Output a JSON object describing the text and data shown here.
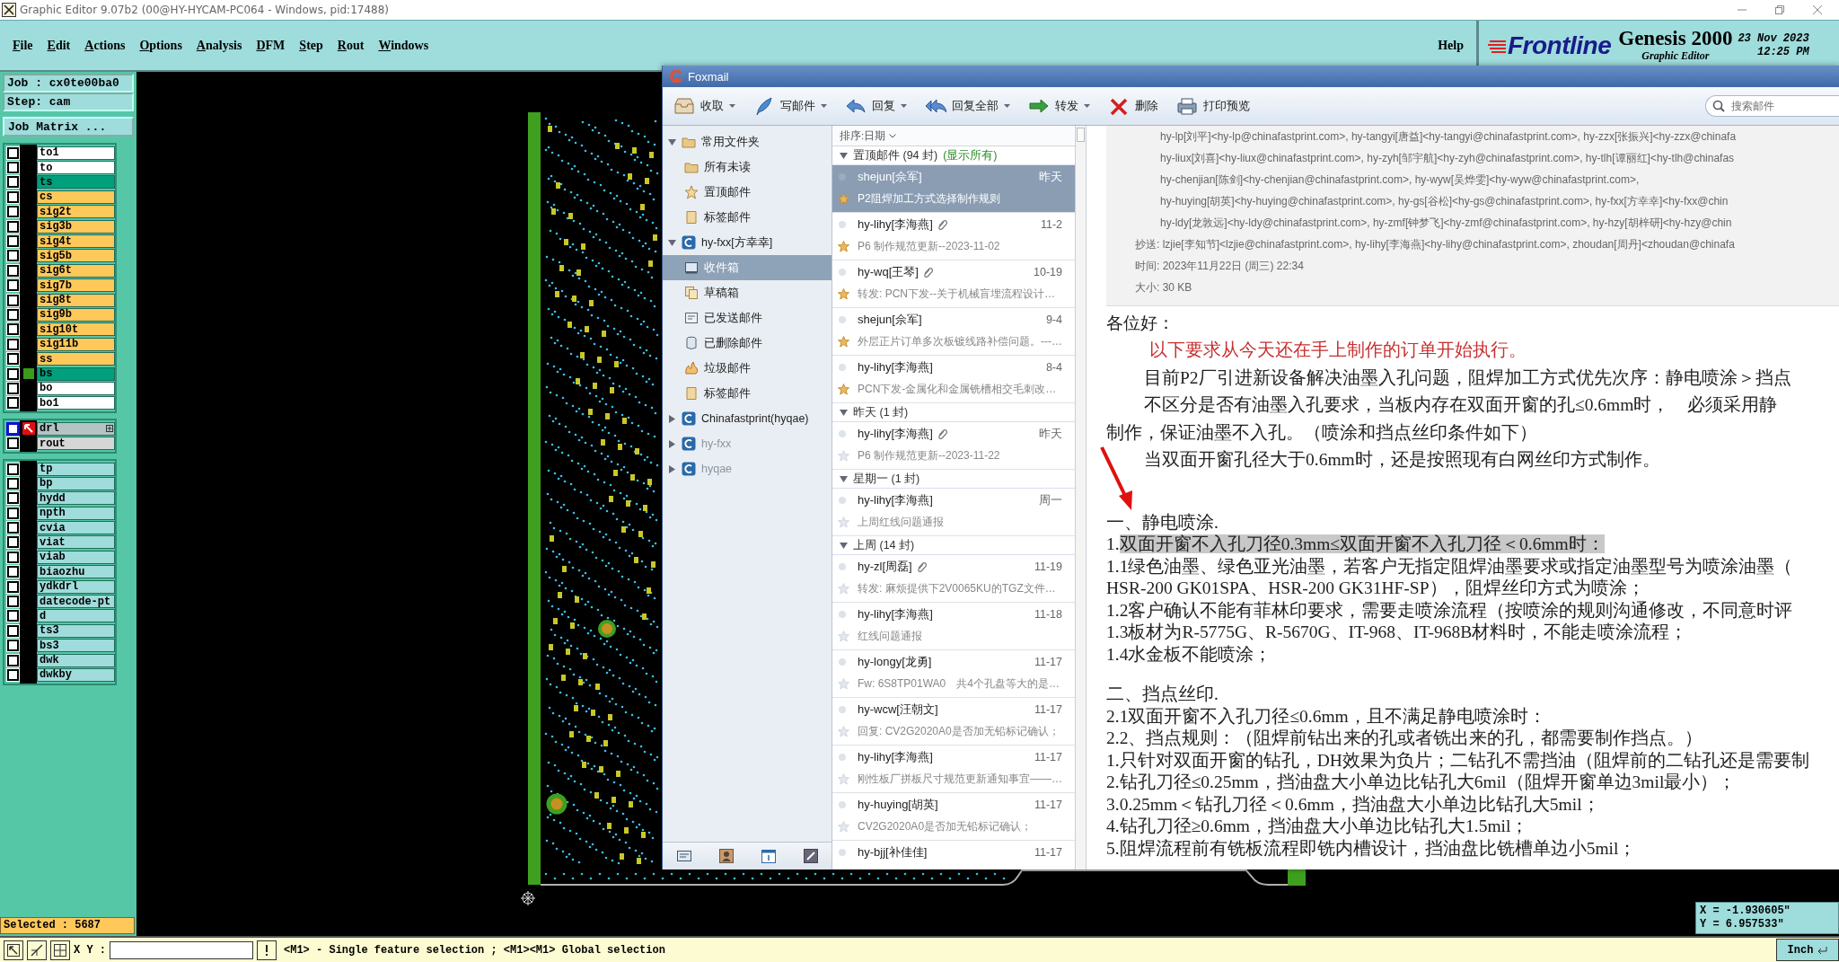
{
  "app_window": {
    "title": "Graphic Editor 9.07b2 (00@HY-HYCAM-PC064 - Windows, pid:17488)"
  },
  "menu": [
    "File",
    "Edit",
    "Actions",
    "Options",
    "Analysis",
    "DFM",
    "Step",
    "Rout",
    "Windows"
  ],
  "help": "Help",
  "brand": {
    "logo": "Frontline",
    "product": "Genesis 2000",
    "subtitle": "Graphic Editor",
    "date": "23 Nov 2023",
    "time": "12:25 PM"
  },
  "job": {
    "job": "Job : cx0te00ba0",
    "step": "Step: cam",
    "matrix_button": "Job Matrix ..."
  },
  "layer_groups": [
    {
      "layers": [
        {
          "name": "to1",
          "color": "#ffffff",
          "checked": false
        },
        {
          "name": "to",
          "color": "#ffffff",
          "checked": false
        },
        {
          "name": "ts",
          "color": "#00a07c",
          "checked": false
        },
        {
          "name": "cs",
          "color": "#ffc85a",
          "checked": false
        },
        {
          "name": "sig2t",
          "color": "#ffc85a",
          "checked": false
        },
        {
          "name": "sig3b",
          "color": "#ffc85a",
          "checked": false
        },
        {
          "name": "sig4t",
          "color": "#ffc85a",
          "checked": false
        },
        {
          "name": "sig5b",
          "color": "#ffc85a",
          "checked": false
        },
        {
          "name": "sig6t",
          "color": "#ffc85a",
          "checked": false
        },
        {
          "name": "sig7b",
          "color": "#ffc85a",
          "checked": false
        },
        {
          "name": "sig8t",
          "color": "#ffc85a",
          "checked": false
        },
        {
          "name": "sig9b",
          "color": "#ffc85a",
          "checked": false
        },
        {
          "name": "sig10t",
          "color": "#ffc85a",
          "checked": false
        },
        {
          "name": "sig11b",
          "color": "#ffc85a",
          "checked": false
        },
        {
          "name": "ss",
          "color": "#ffc85a",
          "checked": false
        },
        {
          "name": "bs",
          "color": "#00a07c",
          "checked": false,
          "affected": true
        },
        {
          "name": "bo",
          "color": "#ffffff",
          "checked": false
        },
        {
          "name": "bo1",
          "color": "#ffffff",
          "checked": false
        }
      ]
    },
    {
      "layers": [
        {
          "name": "drl",
          "color": "#b4c4c4",
          "checked": false,
          "work": true
        },
        {
          "name": "rout",
          "color": "#d6d6d6",
          "checked": false
        }
      ]
    },
    {
      "layers": [
        {
          "name": "tp",
          "color": "#a0dcdc",
          "checked": false
        },
        {
          "name": "bp",
          "color": "#a0dcdc",
          "checked": false
        },
        {
          "name": "hydd",
          "color": "#a0dcdc",
          "checked": false
        },
        {
          "name": "npth",
          "color": "#a0dcdc",
          "checked": false
        },
        {
          "name": "cvia",
          "color": "#a0dcdc",
          "checked": false
        },
        {
          "name": "viat",
          "color": "#a0dcdc",
          "checked": false
        },
        {
          "name": "viab",
          "color": "#a0dcdc",
          "checked": false
        },
        {
          "name": "biaozhu",
          "color": "#a0dcdc",
          "checked": false
        },
        {
          "name": "ydkdrl",
          "color": "#a0dcdc",
          "checked": false
        },
        {
          "name": "datecode-pt",
          "color": "#a0dcdc",
          "checked": false
        },
        {
          "name": "d",
          "color": "#a0dcdc",
          "checked": false
        },
        {
          "name": "ts3",
          "color": "#a0dcdc",
          "checked": false
        },
        {
          "name": "bs3",
          "color": "#a0dcdc",
          "checked": false
        },
        {
          "name": "dwk",
          "color": "#a0dcdc",
          "checked": false
        },
        {
          "name": "dwkby",
          "color": "#a0dcdc",
          "checked": false
        }
      ]
    }
  ],
  "selected_count": "Selected : 5687",
  "coordinates": {
    "x": "X = -1.930605\"",
    "y": "Y = 6.957533\""
  },
  "status_bar": {
    "xy_label": "X Y :",
    "message": "<M1> - Single feature selection ; <M1><M1> Global selection",
    "units": "Inch"
  },
  "foxmail": {
    "title": "Foxmail",
    "toolbar": [
      {
        "label": "收取",
        "dropdown": true
      },
      {
        "label": "写邮件",
        "dropdown": true
      },
      {
        "label": "回复",
        "dropdown": true
      },
      {
        "label": "回复全部",
        "dropdown": true
      },
      {
        "label": "转发",
        "dropdown": true
      },
      {
        "label": "删除",
        "dropdown": false
      },
      {
        "label": "打印预览",
        "dropdown": false
      }
    ],
    "search": {
      "placeholder": "搜索邮件"
    },
    "folders": [
      {
        "label": "常用文件夹",
        "kind": "folder",
        "expanded": true,
        "selected": false,
        "disabled": false,
        "children": [
          {
            "label": "所有未读",
            "kind": "folder",
            "selected": false
          },
          {
            "label": "置顶邮件",
            "kind": "starred",
            "selected": false
          },
          {
            "label": "标签邮件",
            "kind": "tagged",
            "selected": false
          }
        ]
      },
      {
        "label": "hy-fxx[方幸幸]",
        "kind": "account",
        "expanded": true,
        "selected": false,
        "disabled": false,
        "children": [
          {
            "label": "收件箱",
            "kind": "inbox",
            "selected": true
          },
          {
            "label": "草稿箱",
            "kind": "drafts",
            "selected": false
          },
          {
            "label": "已发送邮件",
            "kind": "sent",
            "selected": false
          },
          {
            "label": "已删除邮件",
            "kind": "deleted",
            "selected": false
          },
          {
            "label": "垃圾邮件",
            "kind": "junk",
            "selected": false
          },
          {
            "label": "标签邮件",
            "kind": "tagged",
            "selected": false
          }
        ]
      },
      {
        "label": "Chinafastprint(hyqae)",
        "kind": "account",
        "expanded": false,
        "selected": false,
        "disabled": false
      },
      {
        "label": "hy-fxx",
        "kind": "account",
        "expanded": false,
        "selected": false,
        "disabled": true
      },
      {
        "label": "hyqae",
        "kind": "account",
        "expanded": false,
        "selected": false,
        "disabled": true
      }
    ],
    "sort": "排序:日期",
    "groups": [
      {
        "title": "置顶邮件 (94 封)",
        "link": "(显示所有)",
        "expanded": true,
        "messages": [
          {
            "sender": "shejun[佘军]",
            "date": "昨天",
            "subject": "P2阻焊加工方式选择制作规则",
            "starred": true,
            "attachment": false,
            "selected": true
          },
          {
            "sender": "hy-lihy[李海燕]",
            "date": "11-2",
            "subject": "P6 制作规范更新--2023-11-02",
            "starred": true,
            "attachment": true,
            "selected": false
          },
          {
            "sender": "hy-wq[王琴]",
            "date": "10-19",
            "subject": "转发: PCN下发--关于机械盲埋流程设计…",
            "starred": true,
            "attachment": true,
            "selected": false
          },
          {
            "sender": "shejun[佘军]",
            "date": "9-4",
            "subject": "外层正片订单多次板镀线路补偿问题。---…",
            "starred": true,
            "attachment": false,
            "selected": false
          },
          {
            "sender": "hy-lihy[李海燕]",
            "date": "8-4",
            "subject": "PCN下发-金属化和金属铣槽相交毛刺改…",
            "starred": true,
            "attachment": false,
            "selected": false
          }
        ]
      },
      {
        "title": "昨天 (1 封)",
        "expanded": true,
        "messages": [
          {
            "sender": "hy-lihy[李海燕]",
            "date": "昨天",
            "subject": "P6 制作规范更新--2023-11-22",
            "starred": false,
            "attachment": true,
            "selected": false
          }
        ]
      },
      {
        "title": "星期一 (1 封)",
        "expanded": true,
        "messages": [
          {
            "sender": "hy-lihy[李海燕]",
            "date": "周一",
            "subject": "上周红线问题通报",
            "starred": false,
            "attachment": false,
            "selected": false
          }
        ]
      },
      {
        "title": "上周 (14 封)",
        "expanded": true,
        "messages": [
          {
            "sender": "hy-zl[周磊]",
            "date": "11-19",
            "subject": "转发: 麻烦提供下2V0065KU的TGZ文件…",
            "starred": false,
            "attachment": true,
            "selected": false
          },
          {
            "sender": "hy-lihy[李海燕]",
            "date": "11-18",
            "subject": "红线问题通报",
            "starred": false,
            "attachment": false,
            "selected": false
          },
          {
            "sender": "hy-longy[龙勇]",
            "date": "11-17",
            "subject": "Fw: 6S8TP01WA0　共4个孔盘等大的是…",
            "starred": false,
            "attachment": false,
            "selected": false
          },
          {
            "sender": "hy-wcw[汪朝文]",
            "date": "11-17",
            "subject": "回复: CV2G2020A0是否加无铅标记确认；",
            "starred": false,
            "attachment": false,
            "selected": false
          },
          {
            "sender": "hy-lihy[李海燕]",
            "date": "11-17",
            "subject": "刚性板厂拼板尺寸规范更新通知事宜——…",
            "starred": false,
            "attachment": false,
            "selected": false
          },
          {
            "sender": "hy-huying[胡英]",
            "date": "11-17",
            "subject": "CV2G2020A0是否加无铅标记确认；",
            "starred": false,
            "attachment": false,
            "selected": false
          },
          {
            "sender": "hy-bjj[补佳佳]",
            "date": "11-17",
            "starred": false,
            "attachment": false,
            "selected": false
          }
        ]
      }
    ],
    "header": {
      "recipients": [
        "hy-lp[刘平]<hy-lp@chinafastprint.com>, hy-tangyi[唐益]<hy-tangyi@chinafastprint.com>, hy-zzx[张振兴]<hy-zzx@chinafa",
        "hy-liux[刘喜]<hy-liux@chinafastprint.com>, hy-zyh[邹宇航]<hy-zyh@chinafastprint.com>, hy-tlh[谭丽红]<hy-tlh@chinafas",
        "hy-chenjian[陈剑]<hy-chenjian@chinafastprint.com>, hy-wyw[吴烨雯]<hy-wyw@chinafastprint.com>,",
        "hy-huying[胡英]<hy-huying@chinafastprint.com>, hy-gs[谷松]<hy-gs@chinafastprint.com>, hy-fxx[方幸幸]<hy-fxx@chin",
        "hy-ldy[龙敦远]<hy-ldy@chinafastprint.com>, hy-zmf[钟梦飞]<hy-zmf@chinafastprint.com>, hy-hzy[胡梓研]<hy-hzy@chin"
      ],
      "cc": "抄送: lzjie[李知节]<lzjie@chinafastprint.com>, hy-lihy[李海燕]<hy-lihy@chinafastprint.com>, zhoudan[周丹]<zhoudan@chinafa",
      "time": "时间: 2023年11月22日 (周三) 22:34",
      "size": "大小: 30 KB"
    },
    "body": [
      {
        "kind": "greeting",
        "text": "各位好："
      },
      {
        "kind": "notice",
        "text": "以下要求从今天还在手上制作的订单开始执行。"
      },
      {
        "kind": "indent",
        "text": "目前P2厂引进新设备解决油墨入孔问题，阻焊加工方式优先次序：静电喷涂＞挡点"
      },
      {
        "kind": "indent",
        "text": "不区分是否有油墨入孔要求，当板内存在双面开窗的孔≤0.6mm时，　必须采用静"
      },
      {
        "kind": "plain",
        "text": "制作，保证油墨不入孔。（喷涂和挡点丝印条件如下）"
      },
      {
        "kind": "indent",
        "text": "当双面开窗孔径大于0.6mm时，还是按照现有白网丝印方式制作。"
      },
      {
        "kind": "gap"
      },
      {
        "kind": "line",
        "text": "一、静电喷涂."
      },
      {
        "kind": "marked",
        "prefix": "1.",
        "text": "双面开窗不入孔刀径0.3mm≤双面开窗不入孔刀径＜0.6mm时："
      },
      {
        "kind": "line",
        "text": "1.1绿色油墨、绿色亚光油墨，若客户无指定阻焊油墨要求或指定油墨型号为喷涂油墨（"
      },
      {
        "kind": "line",
        "text": "HSR-200 GK01SPA、HSR-200 GK31HF-SP），阻焊丝印方式为喷涂；"
      },
      {
        "kind": "line",
        "text": "1.2客户确认不能有菲林印要求，需要走喷涂流程（按喷涂的规则沟通修改，不同意时评"
      },
      {
        "kind": "line",
        "text": "1.3板材为R-5775G、R-5670G、IT-968、IT-968B材料时，不能走喷涂流程；"
      },
      {
        "kind": "line",
        "text": "1.4水金板不能喷涂；"
      },
      {
        "kind": "gap"
      },
      {
        "kind": "line",
        "text": "二、挡点丝印."
      },
      {
        "kind": "line",
        "text": "2.1双面开窗不入孔刀径≤0.6mm，且不满足静电喷涂时："
      },
      {
        "kind": "line",
        "text": "2.2、挡点规则：（阻焊前钻出来的孔或者铣出来的孔，都需要制作挡点。）"
      },
      {
        "kind": "line",
        "text": "1.只针对双面开窗的钻孔，DH效果为负片；二钻孔不需挡油（阻焊前的二钻孔还是需要制"
      },
      {
        "kind": "line",
        "text": "2.钻孔刀径≤0.25mm，挡油盘大小单边比钻孔大6mil（阻焊开窗单边3mil最小）；"
      },
      {
        "kind": "line",
        "text": "3.0.25mm＜钻孔刀径＜0.6mm，挡油盘大小单边比钻孔大5mil；"
      },
      {
        "kind": "line",
        "text": "4.钻孔刀径≥0.6mm，挡油盘大小单边比钻孔大1.5mil；"
      },
      {
        "kind": "line",
        "text": "5.阻焊流程前有铣板流程即铣内槽设计，挡油盘比铣槽单边小5mil；"
      }
    ]
  }
}
